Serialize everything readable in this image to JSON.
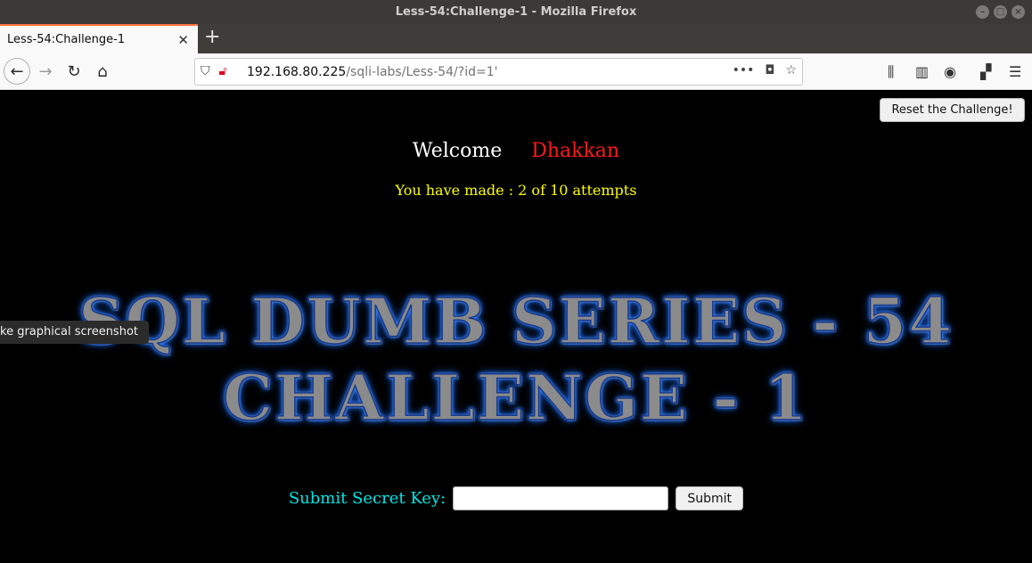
{
  "window": {
    "title": "Less-54:Challenge-1 - Mozilla Firefox"
  },
  "tabs": [
    {
      "label": "Less-54:Challenge-1"
    }
  ],
  "nav": {
    "url_host": "192.168.80.225",
    "url_path": "/sqli-labs/Less-54/?id=1'"
  },
  "icons": [
    "back-arrow-icon",
    "forward-arrow-icon",
    "reload-icon",
    "home-icon",
    "shield-icon",
    "insecure-lock-icon",
    "more-icon",
    "pocket-icon",
    "star-icon",
    "library-icon",
    "sidebar-icon",
    "account-icon",
    "extensions-icon",
    "menu-icon",
    "close-icon",
    "plus-icon"
  ],
  "page": {
    "reset_label": "Reset the Challenge!",
    "welcome_text": "Welcome",
    "user_name": "Dhakkan",
    "attempts_text": "You have made : 2 of 10 attempts",
    "banner_line1": "SQL DUMB SERIES - 54",
    "banner_line2": "CHALLENGE - 1",
    "tooltip": "ke graphical screenshot",
    "secret_label": "Submit Secret Key:",
    "secret_value": "",
    "submit_label": "Submit"
  }
}
